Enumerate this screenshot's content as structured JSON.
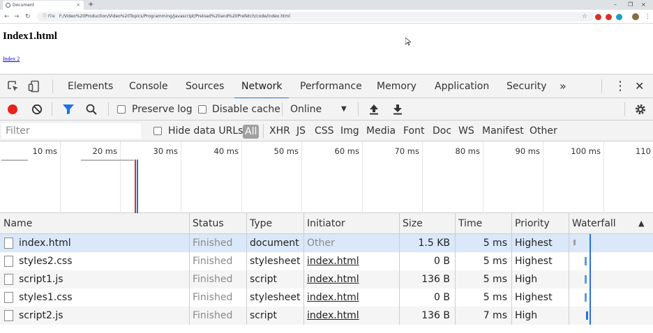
{
  "browser": {
    "tab_title": "Document",
    "tab_close": "×",
    "new_tab": "+",
    "window_controls": [
      "–",
      "❐",
      "×"
    ],
    "scheme_label": "File",
    "url": "F:/Video%20Production/Video%20Topics/Programming/Javascript/Preload%20and%20Prefetch/code/index.html",
    "extension_colors": [
      "#d93025",
      "#d93025",
      "#1a9ccf",
      "#1a73e8"
    ]
  },
  "page": {
    "heading": "Index1.html",
    "link": "Index 2"
  },
  "devtools": {
    "tabs": [
      "Elements",
      "Console",
      "Sources",
      "Network",
      "Performance",
      "Memory",
      "Application",
      "Security"
    ],
    "active_tab": "Network",
    "more_tabs": "»",
    "menu": "⋮",
    "close": "✕",
    "toolbar": {
      "preserve_log": "Preserve log",
      "disable_cache": "Disable cache",
      "throttling": "Online"
    },
    "filter": {
      "placeholder": "Filter",
      "hide_data_urls": "Hide data URLs",
      "types": [
        "All",
        "XHR",
        "JS",
        "CSS",
        "Img",
        "Media",
        "Font",
        "Doc",
        "WS",
        "Manifest",
        "Other"
      ],
      "active_type": "All"
    },
    "overview": {
      "ticks": [
        "10 ms",
        "20 ms",
        "30 ms",
        "40 ms",
        "50 ms",
        "60 ms",
        "70 ms",
        "80 ms",
        "90 ms",
        "100 ms",
        "110"
      ],
      "dom_content_loaded_color": "#2a6edb",
      "load_color": "#d93025"
    },
    "table": {
      "columns": [
        "Name",
        "Status",
        "Type",
        "Initiator",
        "Size",
        "Time",
        "Priority",
        "Waterfall"
      ],
      "sort_indicator": "▲",
      "rows": [
        {
          "name": "index.html",
          "status": "Finished",
          "type": "document",
          "initiator": "Other",
          "size": "1.5 KB",
          "time": "5 ms",
          "priority": "Highest"
        },
        {
          "name": "styles2.css",
          "status": "Finished",
          "type": "stylesheet",
          "initiator": "index.html",
          "size": "0 B",
          "time": "5 ms",
          "priority": "Highest"
        },
        {
          "name": "script1.js",
          "status": "Finished",
          "type": "script",
          "initiator": "index.html",
          "size": "136 B",
          "time": "5 ms",
          "priority": "High"
        },
        {
          "name": "styles1.css",
          "status": "Finished",
          "type": "stylesheet",
          "initiator": "index.html",
          "size": "0 B",
          "time": "5 ms",
          "priority": "Highest"
        },
        {
          "name": "script2.js",
          "status": "Finished",
          "type": "script",
          "initiator": "index.html",
          "size": "136 B",
          "time": "7 ms",
          "priority": "High"
        }
      ]
    }
  }
}
